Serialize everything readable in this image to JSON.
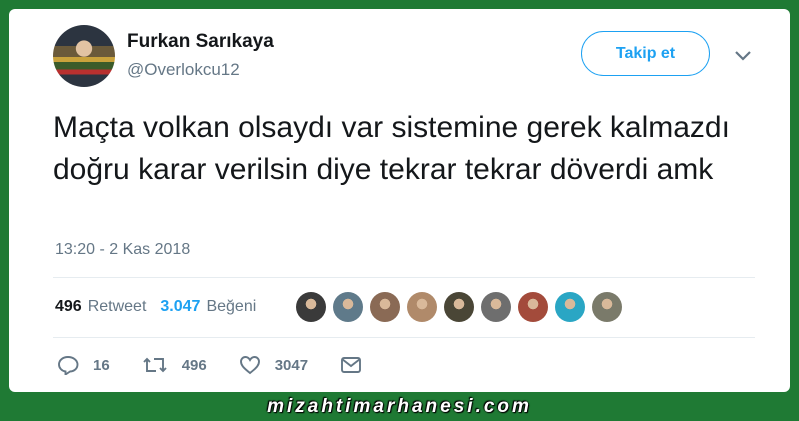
{
  "tweet": {
    "author_name": "Furkan Sarıkaya",
    "author_handle": "@Overlokcu12",
    "follow_label": "Takip et",
    "text": "Maçta volkan olsaydı var sistemine gerek kalmazdı doğru karar verilsin diye tekrar tekrar döverdi amk",
    "timestamp": "13:20 - 2 Kas 2018",
    "retweet_count": "496",
    "retweet_label": "Retweet",
    "like_count": "3.047",
    "like_label": "Beğeni",
    "liker_avatar_colors": [
      "#3a3a3a",
      "#5f7a8a",
      "#8a6a55",
      "#b08a6a",
      "#4a4636",
      "#6e6e6e",
      "#a34b3b",
      "#2aa6c4",
      "#7a7a6a"
    ],
    "actions": {
      "reply_count": "16",
      "retweet_count": "496",
      "like_count": "3047"
    },
    "icons": [
      "reply-icon",
      "retweet-icon",
      "heart-icon",
      "message-icon",
      "chevron-down-icon"
    ]
  },
  "watermark": "mizahtimarhanesi.com",
  "colors": {
    "background": "#1f7a34",
    "accent": "#1da1f2",
    "text": "#14171a",
    "muted": "#657786"
  }
}
